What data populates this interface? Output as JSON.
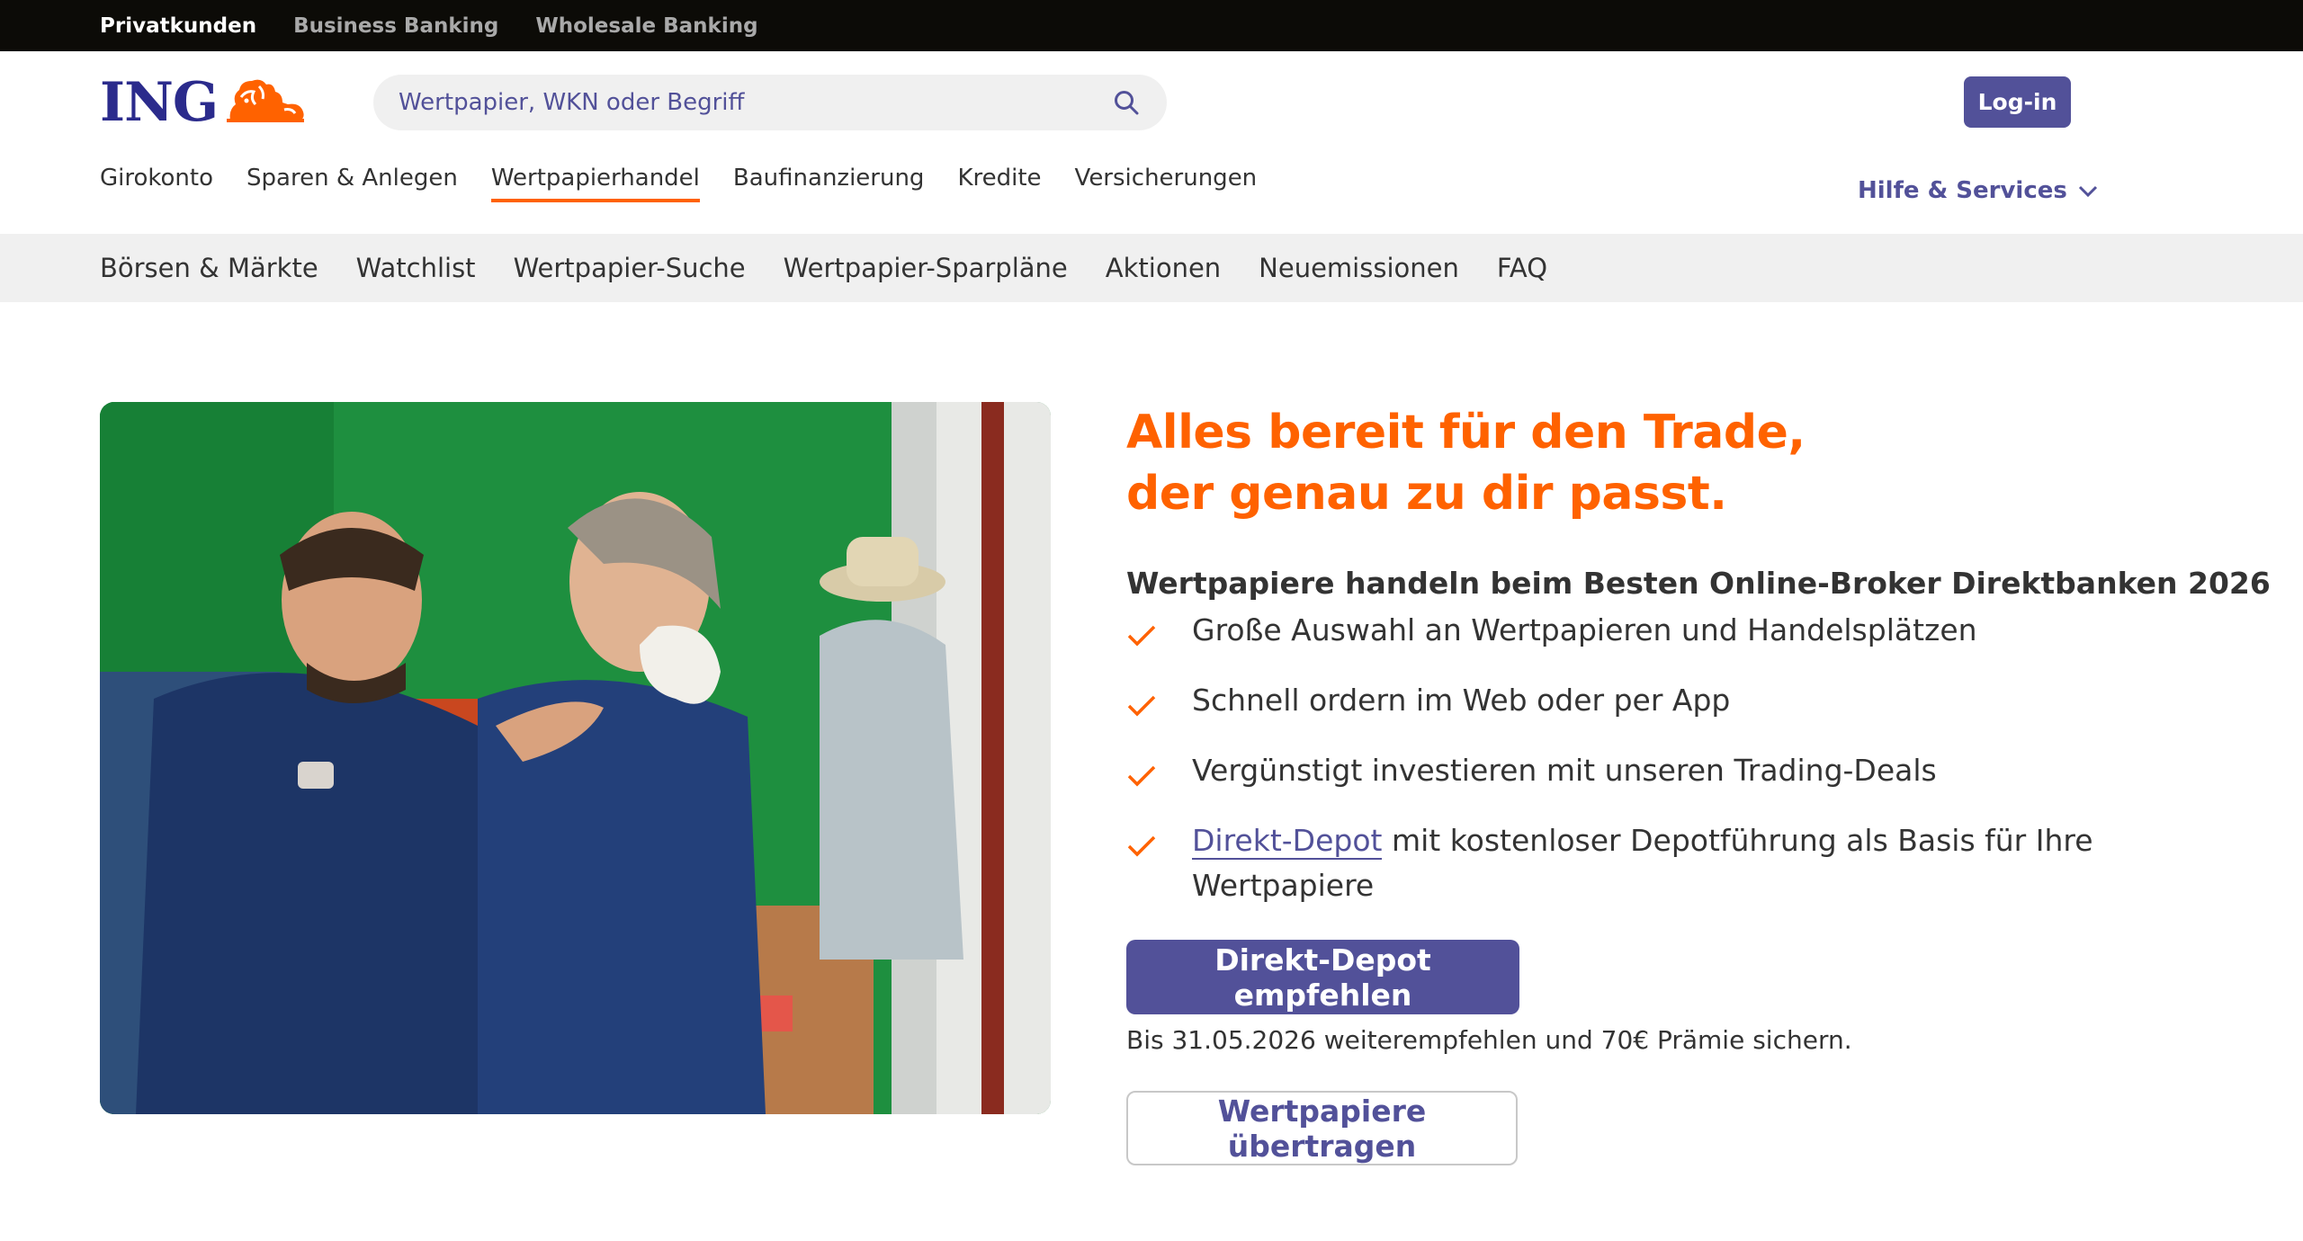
{
  "topbar": {
    "items": [
      {
        "label": "Privatkunden",
        "active": true
      },
      {
        "label": "Business Banking",
        "active": false
      },
      {
        "label": "Wholesale Banking",
        "active": false
      }
    ]
  },
  "header": {
    "logo_text": "ING",
    "search": {
      "placeholder": "Wertpapier, WKN oder Begriff",
      "icon": "search-icon"
    },
    "login_label": "Log-in"
  },
  "mainnav": {
    "items": [
      {
        "label": "Girokonto"
      },
      {
        "label": "Sparen & Anlegen"
      },
      {
        "label": "Wertpapierhandel",
        "active": true
      },
      {
        "label": "Baufinanzierung"
      },
      {
        "label": "Kredite"
      },
      {
        "label": "Versicherungen"
      }
    ],
    "help_label": "Hilfe & Services"
  },
  "subnav": {
    "items": [
      {
        "label": "Börsen & Märkte"
      },
      {
        "label": "Watchlist"
      },
      {
        "label": "Wertpapier-Suche"
      },
      {
        "label": "Wertpapier-Sparpläne"
      },
      {
        "label": "Aktionen"
      },
      {
        "label": "Neuemissionen"
      },
      {
        "label": "FAQ"
      }
    ]
  },
  "hero": {
    "headline_line1": "Alles bereit für den Trade,",
    "headline_line2": "der genau zu dir passt.",
    "subhead": "Wertpapiere handeln beim Besten Online-Broker Direktbanken 2026",
    "features": [
      {
        "text": "Große Auswahl an Wertpapieren und Handelsplätzen"
      },
      {
        "text": "Schnell ordern im Web oder per App"
      },
      {
        "text": "Vergünstigt investieren mit unseren Trading-Deals"
      },
      {
        "link": "Direkt-Depot",
        "text": " mit kostenloser Depotführung als Basis für Ihre Wertpapiere"
      }
    ],
    "primary_button": "Direkt-Depot empfehlen",
    "promo_text": "Bis 31.05.2026 weiterempfehlen und 70€ Prämie sichern.",
    "secondary_button": "Wertpapiere übertragen"
  },
  "colors": {
    "brand_orange": "#ff6200",
    "brand_indigo": "#525199",
    "topbar_bg": "#0c0b07",
    "subnav_bg": "#f0f0f0"
  }
}
